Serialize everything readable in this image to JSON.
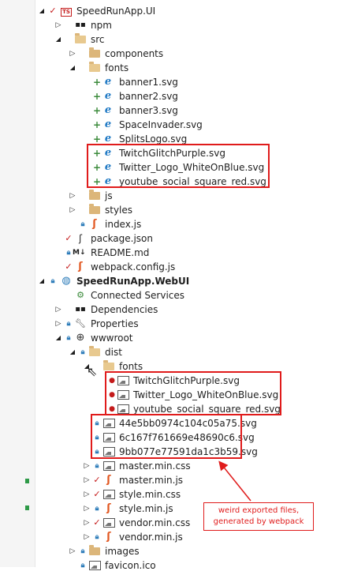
{
  "tree": {
    "root_ui": "SpeedRunApp.UI",
    "npm": "npm",
    "src": "src",
    "components": "components",
    "fonts": "fonts",
    "font_files": [
      "banner1.svg",
      "banner2.svg",
      "banner3.svg",
      "SpaceInvader.svg",
      "SplitsLogo.svg",
      "TwitchGlitchPurple.svg",
      "Twitter_Logo_WhiteOnBlue.svg",
      "youtube_social_square_red.svg"
    ],
    "js": "js",
    "styles": "styles",
    "index_js": "index.js",
    "package_json": "package.json",
    "readme": "README.md",
    "webpack_config": "webpack.config.js",
    "root_webui": "SpeedRunApp.WebUI",
    "connected_services": "Connected Services",
    "dependencies": "Dependencies",
    "properties": "Properties",
    "wwwroot": "wwwroot",
    "dist": "dist",
    "dist_fonts": "fonts",
    "dist_font_files": [
      "TwitchGlitchPurple.svg",
      "Twitter_Logo_WhiteOnBlue.svg",
      "youtube_social_square_red.svg"
    ],
    "exported_files": [
      "44e5bb0974c104c05a75.svg",
      "6c167f761669e48690c6.svg",
      "9bb077e77591da1c3b59.svg"
    ],
    "dist_files": [
      "master.min.css",
      "master.min.js",
      "style.min.css",
      "style.min.js",
      "vendor.min.css",
      "vendor.min.js"
    ],
    "images": "images",
    "favicon": "favicon.ico"
  },
  "annotation": {
    "line1": "weird exported files,",
    "line2": "generated by webpack"
  },
  "colors": {
    "highlight": "#e01b1b",
    "folder": "#dcb67a",
    "svg_icon": "#1c77c3",
    "js_icon": "#e25822"
  },
  "icons": [
    "expand-chevron-icon",
    "collapse-triangle-icon",
    "folder-icon",
    "svg-file-icon",
    "js-file-icon",
    "image-file-icon",
    "lock-icon",
    "red-check-icon",
    "plus-icon",
    "globe-icon"
  ]
}
